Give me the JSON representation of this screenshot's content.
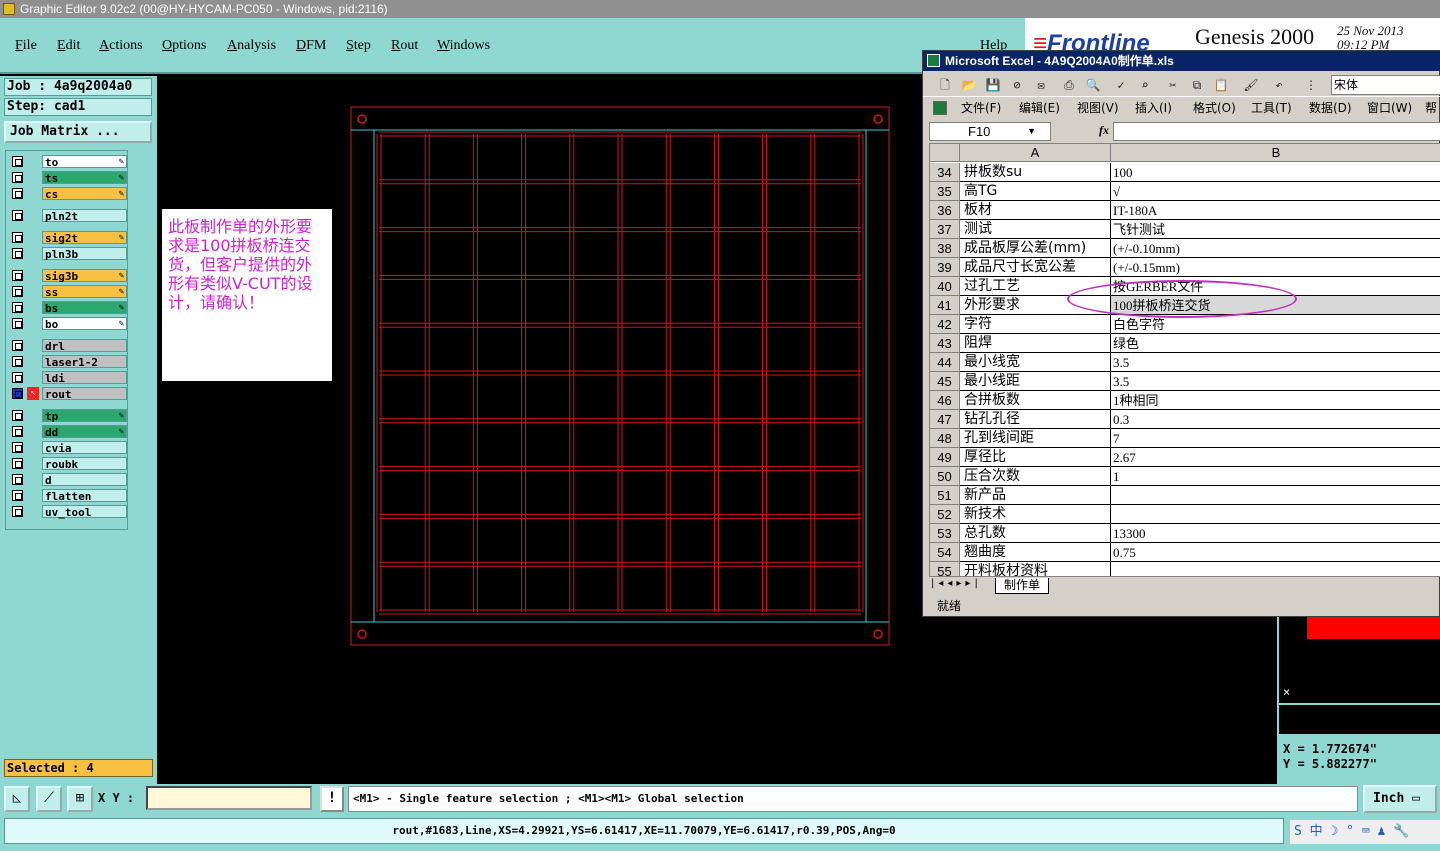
{
  "window": {
    "title": "Graphic Editor 9.02c2 (00@HY-HYCAM-PC050 - Windows, pid:2116)"
  },
  "menu": {
    "items": [
      "File",
      "Edit",
      "Actions",
      "Options",
      "Analysis",
      "DFM",
      "Step",
      "Rout",
      "Windows"
    ],
    "help": "Help"
  },
  "banner": {
    "logo": "Frontline",
    "product": "Genesis 2000",
    "date_line1": "25 Nov 2013",
    "date_line2": "09:12 PM"
  },
  "left_panel": {
    "job": "Job : 4a9q2004a0",
    "step": "Step: cad1",
    "job_matrix": "Job Matrix ...",
    "layers": [
      {
        "name": "to",
        "color": "#ffffff",
        "pen": true
      },
      {
        "name": "ts",
        "color": "#2aa870",
        "pen": true
      },
      {
        "name": "cs",
        "color": "#f8c040",
        "pen": true
      },
      {
        "name": "pln2t",
        "color": "#c0eeea",
        "pen": false
      },
      {
        "name": "sig2t",
        "color": "#f8c040",
        "pen": true
      },
      {
        "name": "pln3b",
        "color": "#c0eeea",
        "pen": false
      },
      {
        "name": "sig3b",
        "color": "#f8c040",
        "pen": true
      },
      {
        "name": "ss",
        "color": "#f8c040",
        "pen": true
      },
      {
        "name": "bs",
        "color": "#2aa870",
        "pen": true
      },
      {
        "name": "bo",
        "color": "#ffffff",
        "pen": true
      },
      {
        "name": "drl",
        "color": "#c0c0c0",
        "pen": false
      },
      {
        "name": "laser1-2",
        "color": "#c0c0c0",
        "pen": false
      },
      {
        "name": "ldi",
        "color": "#c0c0c0",
        "pen": false
      },
      {
        "name": "rout",
        "color": "#c0c0c0",
        "pen": false
      },
      {
        "name": "tp",
        "color": "#2aa870",
        "pen": true
      },
      {
        "name": "dd",
        "color": "#2aa870",
        "pen": true
      },
      {
        "name": "cvia",
        "color": "#c0eeea",
        "pen": false
      },
      {
        "name": "roubk",
        "color": "#c0eeea",
        "pen": false
      },
      {
        "name": "d",
        "color": "#c0eeea",
        "pen": false
      },
      {
        "name": "flatten",
        "color": "#c0eeea",
        "pen": false
      },
      {
        "name": "uv_tool",
        "color": "#c0eeea",
        "pen": false
      }
    ],
    "selected": "Selected : 4"
  },
  "note": {
    "text": "此板制作单的外形要求是100拼板桥连交货，但客户提供的外形有类似V-CUT的设计，请确认！"
  },
  "coords": {
    "x": "X  =  1.772674\"",
    "y": "Y  =  5.882277\""
  },
  "bottom": {
    "xy_label": "X Y :",
    "xy_value": "",
    "excl": "!",
    "message": "<M1> - Single feature selection ; <M1><M1> Global selection",
    "unit": "Inch"
  },
  "status": {
    "text": "rout,#1683,Line,XS=4.29921,YS=6.61417,XE=11.70079,YE=6.61417,r0.39,POS,Ang=0"
  },
  "excel": {
    "title": "Microsoft Excel - 4A9Q2004A0制作单.xls",
    "font": "宋体",
    "menu": [
      "文件(F)",
      "编辑(E)",
      "视图(V)",
      "插入(I)",
      "格式(O)",
      "工具(T)",
      "数据(D)",
      "窗口(W)",
      "帮助"
    ],
    "namebox": "F10",
    "fx": "fx",
    "col_a": "A",
    "col_b": "B",
    "rows": [
      {
        "n": "34",
        "a": "拼板数su",
        "b": "100"
      },
      {
        "n": "35",
        "a": "高TG",
        "b": "√"
      },
      {
        "n": "36",
        "a": "板材",
        "b": "IT-180A"
      },
      {
        "n": "37",
        "a": "测试",
        "b": "飞针测试"
      },
      {
        "n": "38",
        "a": "成品板厚公差(mm)",
        "b": "(+/-0.10mm)"
      },
      {
        "n": "39",
        "a": "成品尺寸长宽公差",
        "b": "(+/-0.15mm)"
      },
      {
        "n": "40",
        "a": "过孔工艺",
        "b": "按GERBER文件"
      },
      {
        "n": "41",
        "a": "外形要求",
        "b": "100拼板桥连交货"
      },
      {
        "n": "42",
        "a": "字符",
        "b": "白色字符"
      },
      {
        "n": "43",
        "a": "阻焊",
        "b": "绿色"
      },
      {
        "n": "44",
        "a": "最小线宽",
        "b": "3.5"
      },
      {
        "n": "45",
        "a": "最小线距",
        "b": "3.5"
      },
      {
        "n": "46",
        "a": "合拼板数",
        "b": "1种相同"
      },
      {
        "n": "47",
        "a": "钻孔孔径",
        "b": "0.3"
      },
      {
        "n": "48",
        "a": "孔到线间距",
        "b": "7"
      },
      {
        "n": "49",
        "a": "厚径比",
        "b": "2.67"
      },
      {
        "n": "50",
        "a": "压合次数",
        "b": "1"
      },
      {
        "n": "51",
        "a": "新产品",
        "b": ""
      },
      {
        "n": "52",
        "a": "新技术",
        "b": ""
      },
      {
        "n": "53",
        "a": "总孔数",
        "b": "13300"
      },
      {
        "n": "54",
        "a": "翘曲度",
        "b": "0.75"
      },
      {
        "n": "55",
        "a": "开料板材资料",
        "b": ""
      }
    ],
    "sheet_tab": "制作单",
    "status": "就绪"
  },
  "colors": {
    "panel": "#8fd8d2",
    "board_outline": "#d01818",
    "guide": "#3ec8d0"
  }
}
